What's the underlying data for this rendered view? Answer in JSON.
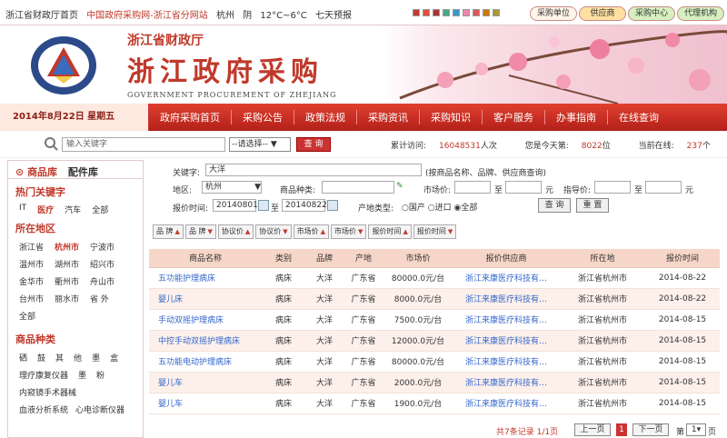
{
  "topbar": {
    "links": [
      "浙江省财政厅首页",
      "中国政府采购网-浙江省分网站"
    ],
    "city": "杭州",
    "weather": "阴",
    "temp": "12°C~6°C",
    "forecast": "七天预报",
    "tabs": [
      "采购单位",
      "供应商",
      "采购中心",
      "代理机构"
    ],
    "squareColors": [
      "#c0392b",
      "#e74c3c",
      "#a33",
      "#4a8",
      "#39c",
      "#e8a",
      "#d55",
      "#c70",
      "#a93"
    ]
  },
  "header": {
    "dept": "浙江省财政厅",
    "title": "浙江政府采购",
    "english": "GOVERNMENT PROCUREMENT OF ZHEJIANG"
  },
  "nav": {
    "date": "2014年8月22日 星期五",
    "items": [
      "政府采购首页",
      "采购公告",
      "政策法规",
      "采购资讯",
      "采购知识",
      "客户服务",
      "办事指南",
      "在线查询"
    ]
  },
  "search": {
    "placeholder": "输入关键字",
    "select": "--请选择--",
    "button": "查 询",
    "statsLabel1": "累计访问:",
    "statsVal1": "16048531",
    "statsSuf1": "人次",
    "statsLabel2": "您是今天第:",
    "statsVal2": "8022",
    "statsSuf2": "位",
    "statsLabel3": "当前在线:",
    "statsVal3": "237",
    "statsSuf3": "个"
  },
  "sidebar": {
    "tab1": "商品库",
    "tab2": "配件库",
    "hotTitle": "热门关键字",
    "hot": [
      "IT",
      "医疗",
      "汽车",
      "全部"
    ],
    "regionTitle": "所在地区",
    "regions": [
      "浙江省",
      "杭州市",
      "宁波市",
      "温州市",
      "湖州市",
      "绍兴市",
      "金华市",
      "衢州市",
      "舟山市",
      "台州市",
      "丽水市",
      "省 外",
      "全部"
    ],
    "catTitle": "商品种类",
    "cats1": [
      "硒",
      "鼓",
      "其",
      "他",
      "墨",
      "盒"
    ],
    "cats2": [
      "理疗康复仪器",
      "墨",
      "粉"
    ],
    "cats3": "内窥镜手术器械",
    "cats4": "血液分析系统",
    "cats4b": "心电诊断仪器"
  },
  "form": {
    "kwLabel": "关键字:",
    "kwValue": "大洋",
    "kwHint": "(按商品名称、品牌、供应商查询)",
    "regionLabel": "地区:",
    "regionValue": "杭州",
    "typeLabel": "商品种类:",
    "mktLabel": "市场价:",
    "to1": "至",
    "unit1": "元",
    "guideLabel": "指导价:",
    "to2": "至",
    "unit2": "元",
    "timeLabel": "报价时间:",
    "dateFrom": "20140801",
    "to3": "至",
    "dateTo": "20140822",
    "originLabel": "产地类型:",
    "origin": [
      "国产",
      "进口",
      "全部"
    ],
    "queryBtn": "查 询",
    "resetBtn": "重 置"
  },
  "sort": [
    "品 牌",
    "品 牌",
    "协议价",
    "协议价",
    "市场价",
    "市场价",
    "报价时间",
    "报价时间"
  ],
  "table": {
    "headers": [
      "商品名称",
      "类别",
      "品牌",
      "产地",
      "市场价",
      "报价供应商",
      "所在地",
      "报价时间"
    ],
    "rows": [
      [
        "五功能护理病床",
        "病床",
        "大洋",
        "广东省",
        "80000.0元/台",
        "浙江来康医疗科技有…",
        "浙江省杭州市",
        "2014-08-22"
      ],
      [
        "婴儿床",
        "病床",
        "大洋",
        "广东省",
        "8000.0元/台",
        "浙江来康医疗科技有…",
        "浙江省杭州市",
        "2014-08-22"
      ],
      [
        "手动双摇护理病床",
        "病床",
        "大洋",
        "广东省",
        "7500.0元/台",
        "浙江来康医疗科技有…",
        "浙江省杭州市",
        "2014-08-15"
      ],
      [
        "中控手动双摇护理病床",
        "病床",
        "大洋",
        "广东省",
        "12000.0元/台",
        "浙江来康医疗科技有…",
        "浙江省杭州市",
        "2014-08-15"
      ],
      [
        "五功能电动护理病床",
        "病床",
        "大洋",
        "广东省",
        "80000.0元/台",
        "浙江来康医疗科技有…",
        "浙江省杭州市",
        "2014-08-15"
      ],
      [
        "婴儿车",
        "病床",
        "大洋",
        "广东省",
        "2000.0元/台",
        "浙江来康医疗科技有…",
        "浙江省杭州市",
        "2014-08-15"
      ],
      [
        "婴儿车",
        "病床",
        "大洋",
        "广东省",
        "1900.0元/台",
        "浙江来康医疗科技有…",
        "浙江省杭州市",
        "2014-08-15"
      ]
    ]
  },
  "pager": {
    "summary": "共7条记录 1/1页",
    "prev": "上一页",
    "current": "1",
    "next": "下一页",
    "goPrefix": "第",
    "goValue": "1",
    "goSuffix": "页"
  }
}
